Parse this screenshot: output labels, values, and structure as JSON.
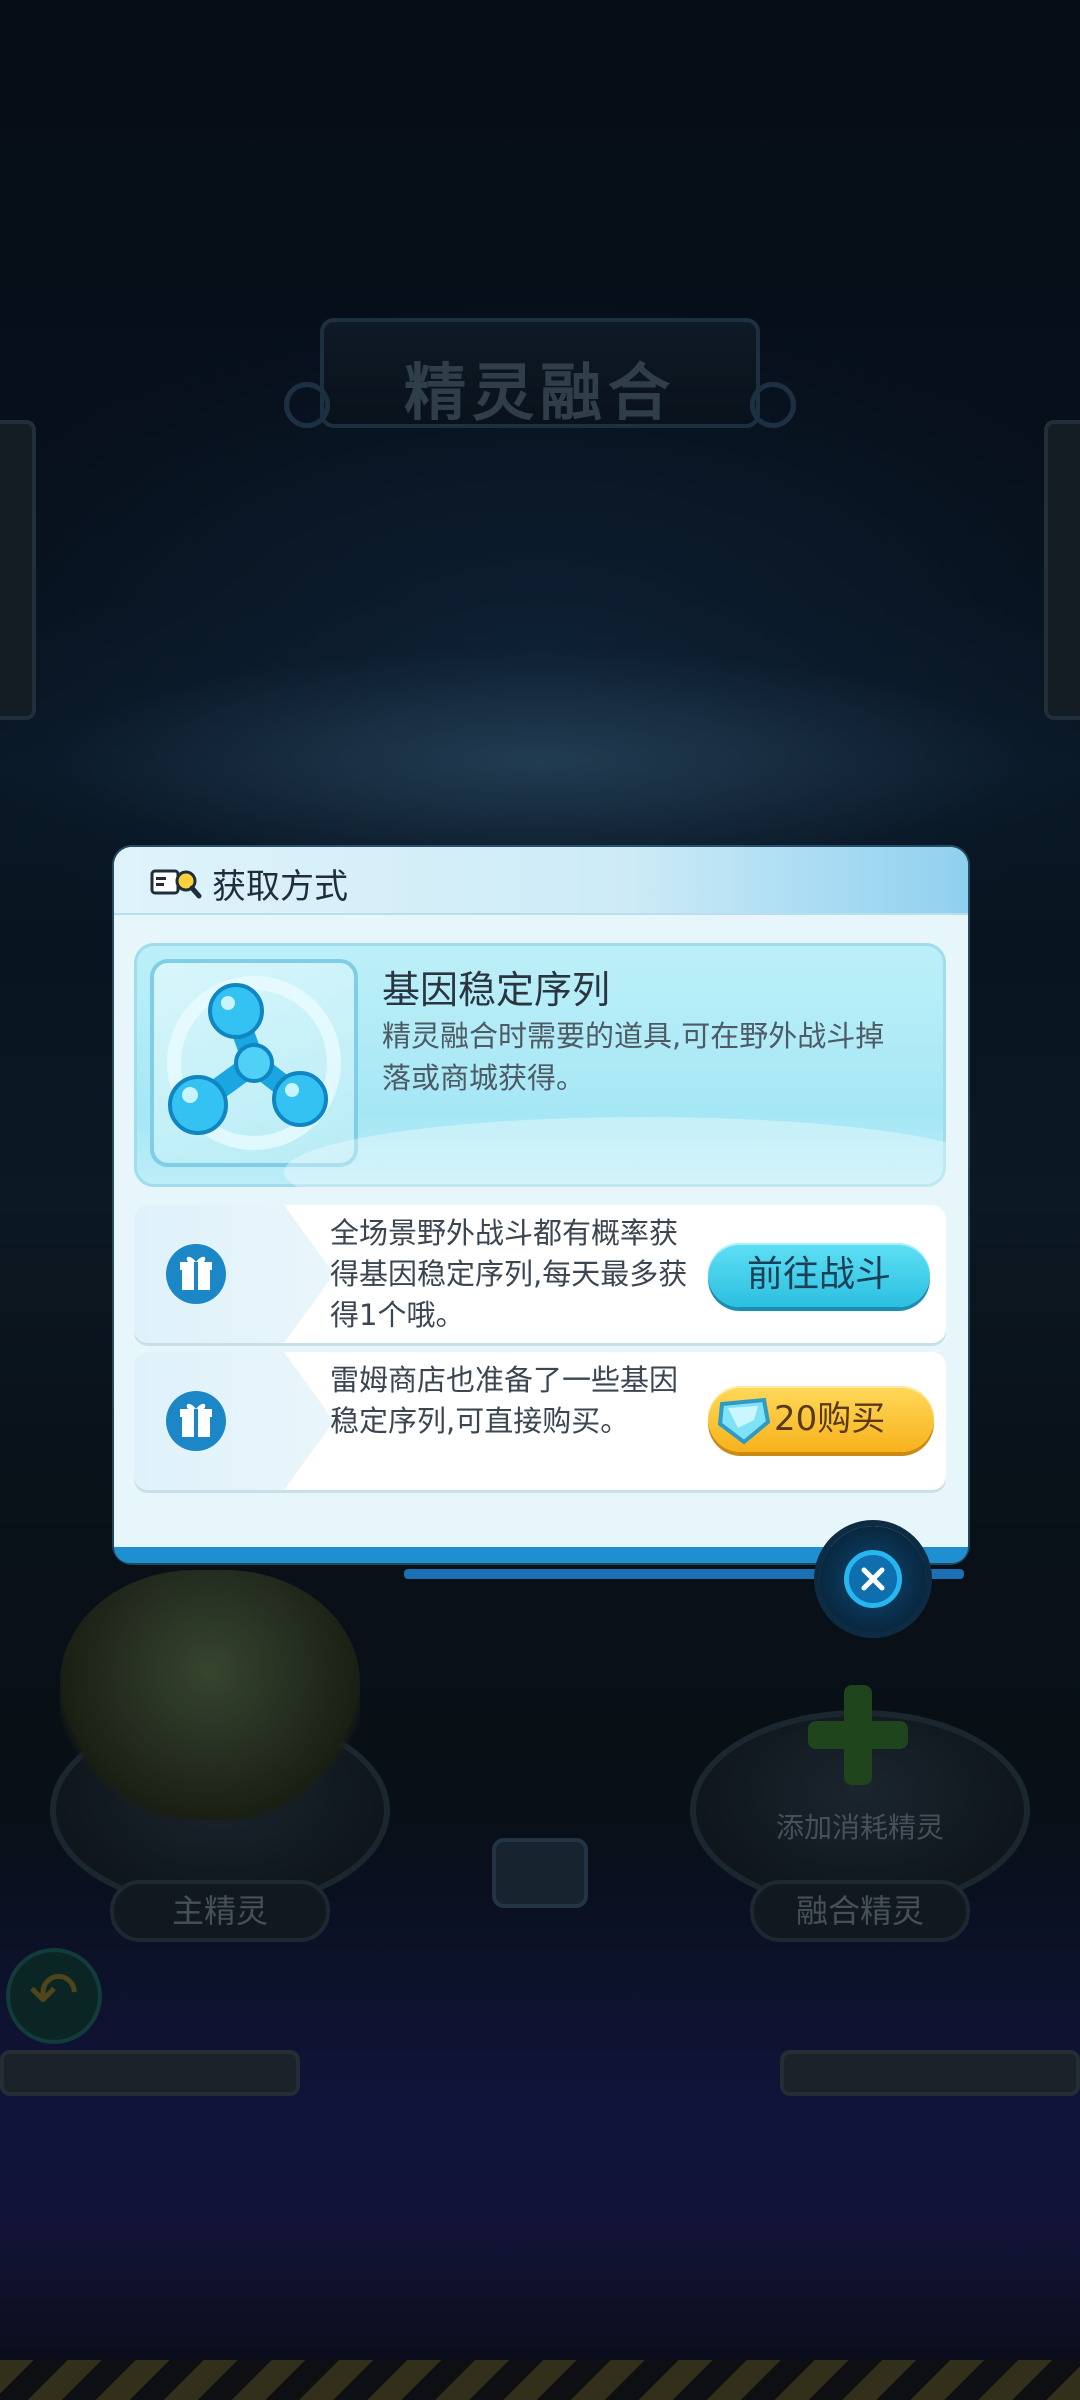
{
  "background": {
    "title": "精灵融合",
    "main_sprite_label": "主精灵",
    "fusion_sprite_label": "融合精灵",
    "add_consumable_label": "添加消耗精灵"
  },
  "dialog": {
    "title": "获取方式",
    "item": {
      "name": "基因稳定序列",
      "description": "精灵融合时需要的道具,可在野外战斗掉落或商城获得。"
    },
    "options": [
      {
        "text": "全场景野外战斗都有概率获得基因稳定序列,每天最多获得1个哦。",
        "button_label": "前往战斗"
      },
      {
        "text": "雷姆商店也准备了一些基因稳定序列,可直接购买。",
        "price": "20",
        "button_label": "购买"
      }
    ]
  },
  "colors": {
    "dialog_bg": "#e6f6fb",
    "battle_button": "#2bbfe0",
    "buy_button": "#f7b21c",
    "gift_icon": "#1c87c7"
  }
}
